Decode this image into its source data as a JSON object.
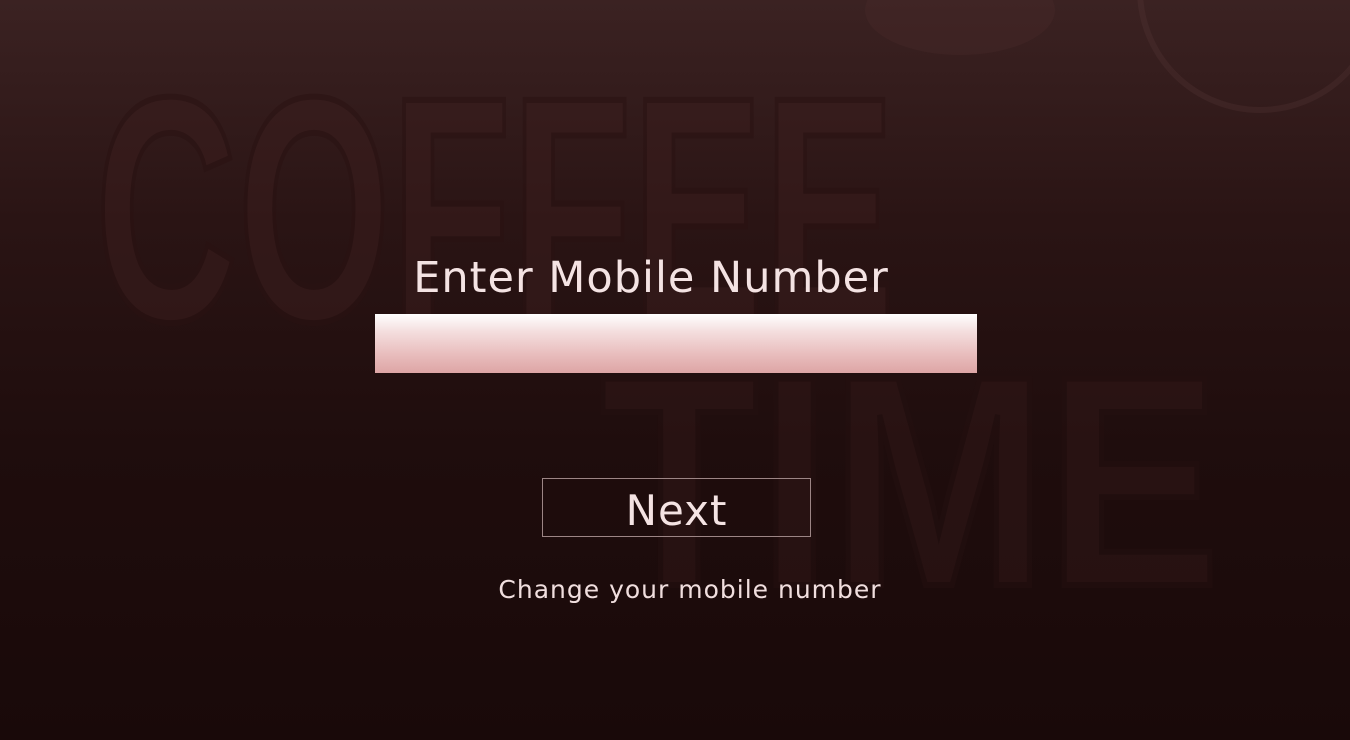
{
  "login": {
    "title": "Enter Mobile Number",
    "phone_value": "",
    "phone_placeholder": "",
    "next_label": "Next",
    "change_link": "Change your mobile number"
  },
  "colors": {
    "text": "#f4e3e3",
    "input_top": "#ffffff",
    "input_bottom": "#dda5a5",
    "background_top": "#3b2222",
    "background_bottom": "#190909",
    "button_border": "#9c8585"
  },
  "background": {
    "word_top": "COFFEE",
    "word_bottom": "TIME"
  }
}
